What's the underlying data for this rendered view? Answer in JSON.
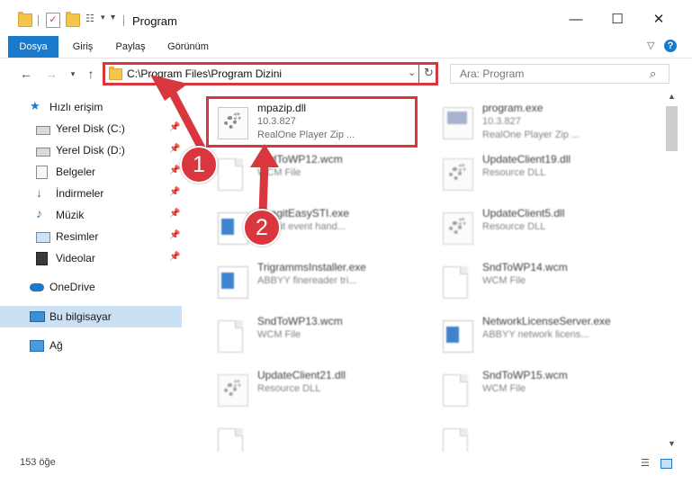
{
  "window": {
    "title": "Program",
    "controls": {
      "minimize": "—",
      "maximize": "☐",
      "close": "✕"
    }
  },
  "ribbon": {
    "tabs": [
      "Dosya",
      "Giriş",
      "Paylaş",
      "Görünüm"
    ],
    "active_tab": "Dosya",
    "help_icon": "?"
  },
  "addressbar": {
    "path": "C:\\Program Files\\Program Dizini",
    "search_placeholder": "Ara: Program"
  },
  "nav_pane": {
    "quick_access": {
      "label": "Hızlı erişim",
      "icon": "star-icon"
    },
    "items": [
      {
        "label": "Yerel Disk (C:)",
        "icon": "drive-icon",
        "pinned": true
      },
      {
        "label": "Yerel Disk (D:)",
        "icon": "drive-icon",
        "pinned": true
      },
      {
        "label": "Belgeler",
        "icon": "documents-icon",
        "pinned": true
      },
      {
        "label": "İndirmeler",
        "icon": "download-icon",
        "pinned": true
      },
      {
        "label": "Müzik",
        "icon": "music-icon",
        "pinned": true
      },
      {
        "label": "Resimler",
        "icon": "pictures-icon",
        "pinned": true
      },
      {
        "label": "Videolar",
        "icon": "video-icon",
        "pinned": true
      }
    ],
    "onedrive": {
      "label": "OneDrive",
      "icon": "cloud-icon"
    },
    "this_pc": {
      "label": "Bu bilgisayar",
      "icon": "computer-icon",
      "selected": true
    },
    "network": {
      "label": "Ağ",
      "icon": "network-icon"
    }
  },
  "files": [
    {
      "name": "mpazip.dll",
      "line1": "10.3.827",
      "line2": "RealOne Player Zip ...",
      "icon": "dll-icon",
      "highlighted": true
    },
    {
      "name": "program.exe",
      "line1": "10.3.827",
      "line2": "RealOne Player Zip ...",
      "icon": "exe-icon"
    },
    {
      "name": "SndToWP12.wcm",
      "line1": "WCM File",
      "line2": "",
      "icon": "document-icon"
    },
    {
      "name": "UpdateClient19.dll",
      "line1": "Resource DLL",
      "line2": "",
      "icon": "dll-icon"
    },
    {
      "name": "SnagitEasySTI.exe",
      "line1": "Snagit event hand...",
      "line2": "",
      "icon": "exe-icon"
    },
    {
      "name": "UpdateClient5.dll",
      "line1": "Resource DLL",
      "line2": "",
      "icon": "dll-icon"
    },
    {
      "name": "TrigrammsInstaller.exe",
      "line1": "ABBYY finereader tri...",
      "line2": "",
      "icon": "exe-icon"
    },
    {
      "name": "SndToWP14.wcm",
      "line1": "WCM File",
      "line2": "",
      "icon": "document-icon"
    },
    {
      "name": "SndToWP13.wcm",
      "line1": "WCM File",
      "line2": "",
      "icon": "document-icon"
    },
    {
      "name": "NetworkLicenseServer.exe",
      "line1": "ABBYY network licens...",
      "line2": "",
      "icon": "exe-icon"
    },
    {
      "name": "UpdateClient21.dll",
      "line1": "Resource DLL",
      "line2": "",
      "icon": "dll-icon"
    },
    {
      "name": "SndToWP15.wcm",
      "line1": "WCM File",
      "line2": "",
      "icon": "document-icon"
    }
  ],
  "annotations": [
    "1",
    "2"
  ],
  "status": {
    "item_count": "153 öğe"
  },
  "colors": {
    "accent": "#1979ca",
    "annotation_red": "#d9363e",
    "selection": "#cce0f3"
  }
}
